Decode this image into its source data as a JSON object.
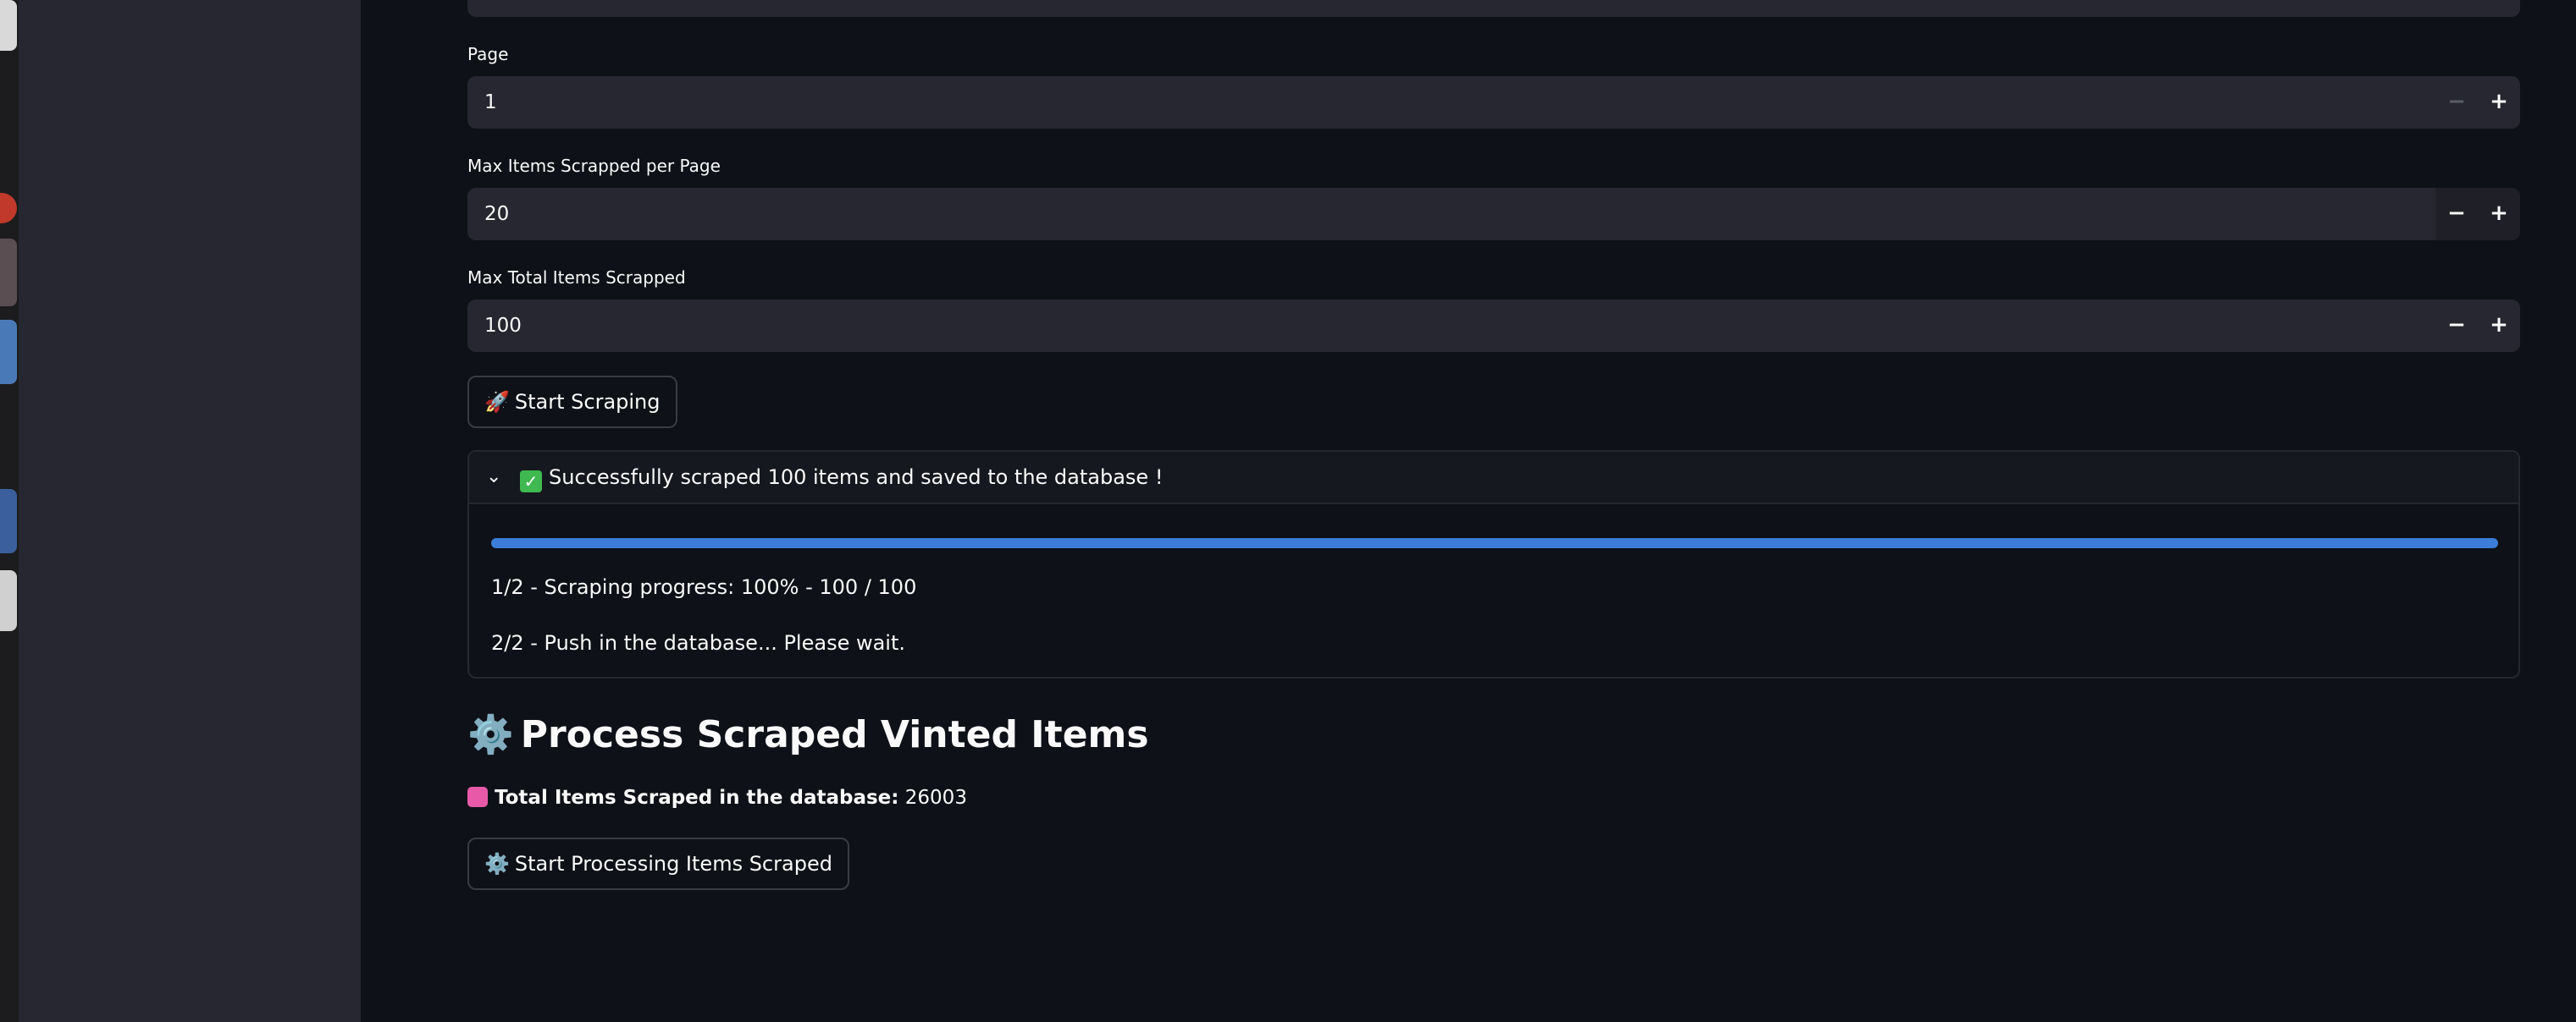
{
  "fields": [
    {
      "label": "Page",
      "value": "1",
      "minus": "−",
      "plus": "+",
      "minus_disabled": true
    },
    {
      "label": "Max Items Scrapped per Page",
      "value": "20",
      "minus": "−",
      "plus": "+",
      "minus_disabled": false
    },
    {
      "label": "Max Total Items Scrapped",
      "value": "100",
      "minus": "−",
      "plus": "+",
      "minus_disabled": false
    }
  ],
  "start_scraping": {
    "emoji": "🚀",
    "label": "Start Scraping"
  },
  "expander": {
    "chevron": "⌄",
    "emoji": "✓",
    "title": "Successfully scraped 100 items and saved to the database !",
    "progress_percent": 100,
    "progress_color": "#3b7dd8",
    "lines": [
      "1/2 - Scraping progress: 100% - 100 / 100",
      "2/2 - Push in the database... Please wait."
    ]
  },
  "process_section": {
    "heading_emoji": "⚙️",
    "heading": "Process Scraped Vinted Items",
    "total_label": "Total Items Scraped in the database:",
    "total_value": "26003",
    "button_emoji": "⚙️",
    "button_label": "Start Processing Items Scraped"
  },
  "theme": {
    "background": "#0e1117",
    "sidebar": "#262730",
    "accent": "#3b7dd8"
  }
}
